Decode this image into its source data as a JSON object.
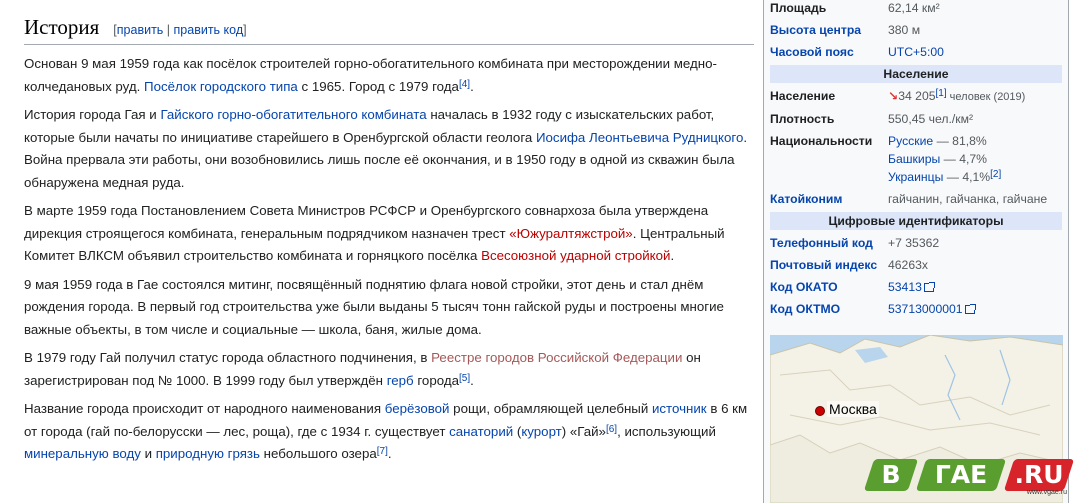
{
  "section": {
    "title": "История",
    "edit_open": "[",
    "edit_link1": "править",
    "edit_sep": " | ",
    "edit_link2": "править код",
    "edit_close": "]"
  },
  "paragraphs": {
    "p1": {
      "t1": "Основан 9 мая 1959 года как посёлок строителей горно-обогатительного комбината при месторождении медно-колчедановых руд. ",
      "link1": "Посёлок городского типа",
      "t2": " с 1965. Город с 1979 года",
      "ref1": "[4]",
      "t3": "."
    },
    "p2": {
      "t1": "История города Гая и ",
      "link1": "Гайского горно-обогатительного комбината",
      "t2": " началась в 1932 году с изыскательских работ, которые были начаты по инициативе старейшего в Оренбургской области геолога ",
      "link2": "Иосифа Леонтьевича Рудницкого",
      "t3": ". Война прервала эти работы, они возобновились лишь после её окончания, и в 1950 году в одной из скважин была обнаружена медная руда."
    },
    "p3": {
      "t1": "В марте 1959 года Постановлением Совета Министров РСФСР и Оренбургского совнархоза была утверждена дирекция строящегося комбината, генеральным подрядчиком назначен трест ",
      "link1": "«Южуралтяжстрой»",
      "t2": ". Центральный Комитет ВЛКСМ объявил строительство комбината и горняцкого посёлка ",
      "link2": "Всесоюзной ударной стройкой",
      "t3": "."
    },
    "p4": {
      "t1": "9 мая 1959 года в Гае состоялся митинг, посвящённый поднятию флага новой стройки, этот день и стал днём рождения города. В первый год строительства уже были выданы 5 тысяч тонн гайской руды и построены многие важные объекты, в том числе и социальные — школа, баня, жилые дома."
    },
    "p5": {
      "t1": "В 1979 году Гай получил статус города областного подчинения, в ",
      "link1": "Реестре городов Российской Федерации",
      "t2": " он зарегистрирован под № 1000. В 1999 году был утверждён ",
      "link2": "герб",
      "t3": " города",
      "ref1": "[5]",
      "t4": "."
    },
    "p6": {
      "t1": "Название города происходит от народного наименования ",
      "link1": "берёзовой",
      "t2": " рощи, обрамляющей целебный ",
      "link2": "источник",
      "t3": " в 6 км от города (гай по-белорусски — лес, роща), где с 1934 г. существует ",
      "link3": "санаторий",
      "t4": " (",
      "link4": "курорт",
      "t5": ") «Гай»",
      "ref1": "[6]",
      "t6": ", использующий ",
      "link5": "минеральную воду",
      "t7": " и ",
      "link6": "природную грязь",
      "t8": " небольшого озера",
      "ref2": "[7]",
      "t9": "."
    }
  },
  "infobox": {
    "area": {
      "label": "Площадь",
      "value": "62,14 км²"
    },
    "elevation": {
      "label": "Высота центра",
      "value": "380 м"
    },
    "timezone": {
      "label": "Часовой пояс",
      "value": "UTC+5:00"
    },
    "population_header": "Население",
    "population": {
      "label": "Население",
      "trend": "↘",
      "value": "34 205",
      "ref": "[1]",
      "suffix": " человек (2019)"
    },
    "density": {
      "label": "Плотность",
      "value": "550,45 чел./км²"
    },
    "nationalities": {
      "label": "Национальности",
      "n1": {
        "name": "Русские",
        "pct": " — 81,8%"
      },
      "n2": {
        "name": "Башкиры",
        "pct": " — 4,7%"
      },
      "n3": {
        "name": "Украинцы",
        "pct": " — 4,1%",
        "ref": "[2]"
      }
    },
    "katoikonym": {
      "label": "Катойконим",
      "value": "гайчанин, гайчанка, гайчане"
    },
    "ids_header": "Цифровые идентификаторы",
    "phone_code": {
      "label": "Телефонный код",
      "value": "+7 35362"
    },
    "postal": {
      "label": "Почтовый индекс",
      "value": "46263x"
    },
    "okato": {
      "label": "Код ОКАТО",
      "value": "53413"
    },
    "oktmo": {
      "label": "Код ОКТМО",
      "value": "53713000001"
    },
    "map_city": "Москва"
  },
  "watermark": {
    "l1": "В",
    "l2": "ГАЕ",
    "l3": ".RU",
    "sub": "www.vgae.ru",
    "colors": {
      "green": "#5a9e2f",
      "red": "#d6242a"
    }
  }
}
